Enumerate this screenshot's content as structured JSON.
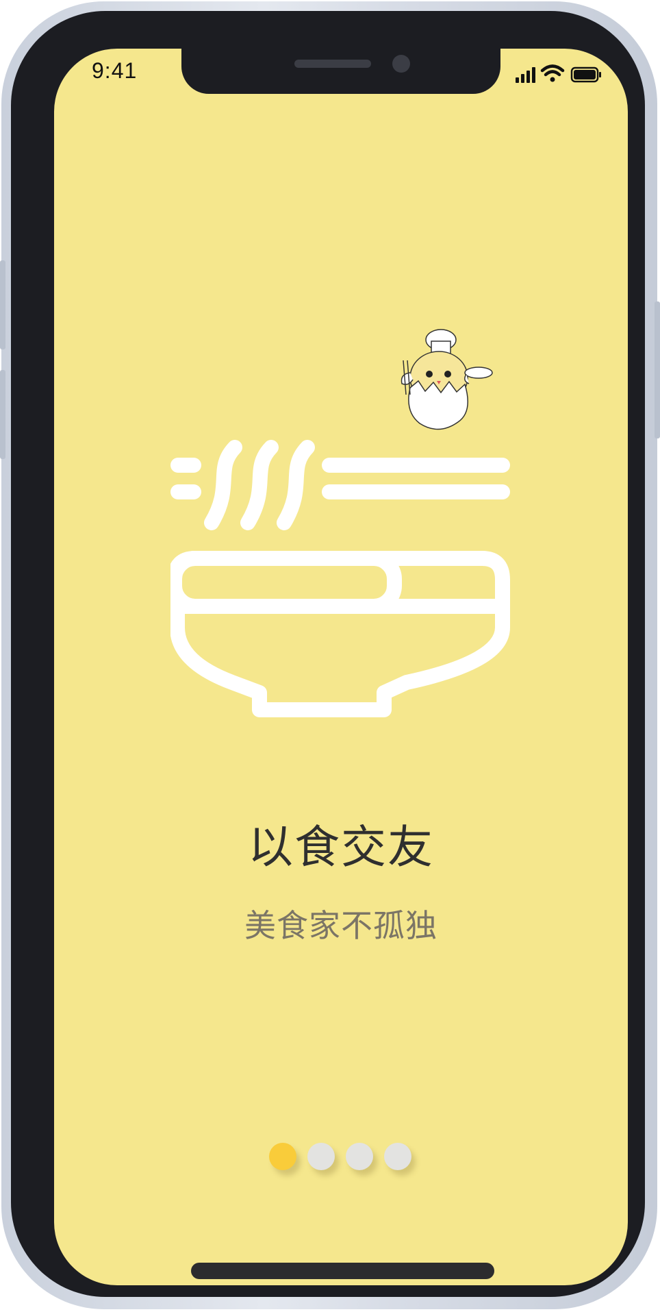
{
  "status_bar": {
    "time": "9:41",
    "icons": [
      "signal-icon",
      "wifi-icon",
      "battery-icon"
    ]
  },
  "onboarding": {
    "title": "以食交友",
    "subtitle": "美食家不孤独",
    "illustration_icon": "noodle-bowl-icon",
    "mascot_icon": "chick-chef-mascot",
    "pages_total": 4,
    "current_page": 1
  },
  "colors": {
    "screen_background": "#f5e78d",
    "illustration_stroke": "#ffffff",
    "active_dot": "#f9cc3a",
    "inactive_dot": "#e3e3e1",
    "title_text": "#2f2f2f",
    "subtitle_text": "#7b7566"
  }
}
